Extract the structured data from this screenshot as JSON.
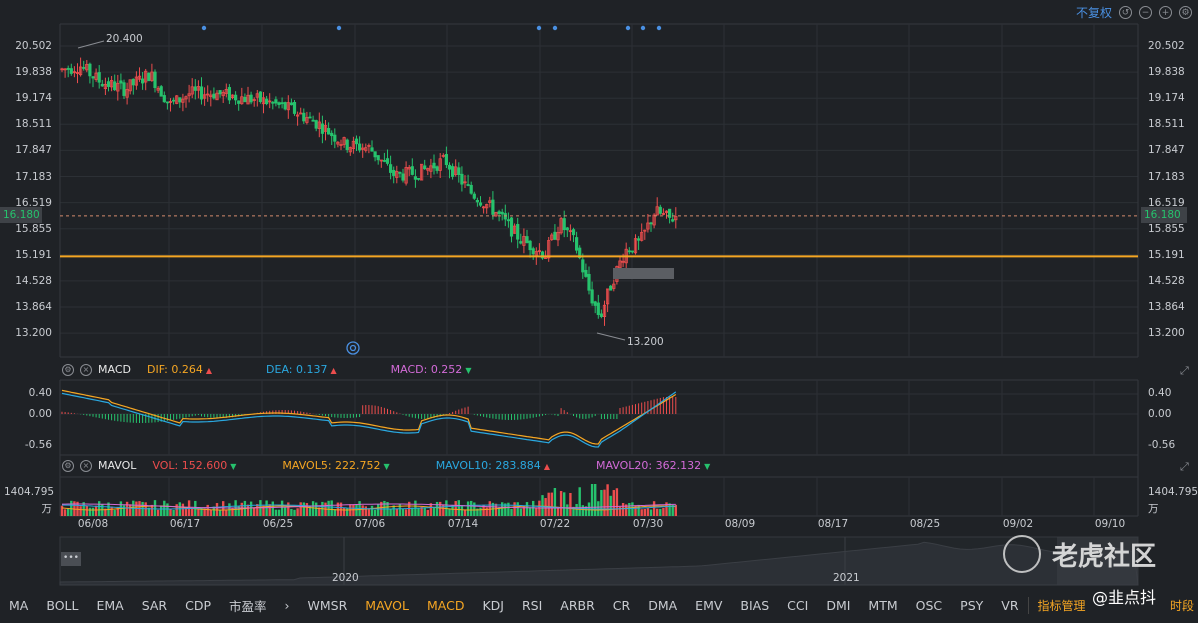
{
  "top": {
    "no_restore": "不复权"
  },
  "main": {
    "yticks": [
      "20.502",
      "19.838",
      "19.174",
      "18.511",
      "17.847",
      "17.183",
      "16.519",
      "15.855",
      "15.191",
      "14.528",
      "13.864",
      "13.200"
    ],
    "current_price": "16.180",
    "high_label": "20.400",
    "low_label": "13.200",
    "support_level": 15.15,
    "current_price_value": 16.18
  },
  "macd": {
    "name": "MACD",
    "dif": "DIF: 0.264",
    "dea": "DEA: 0.137",
    "macd": "MACD: 0.252",
    "yticks": [
      "0.40",
      "0.00",
      "-0.56"
    ]
  },
  "mavol": {
    "name": "MAVOL",
    "vol": "VOL: 152.600",
    "ma5": "MAVOL5: 222.752",
    "ma10": "MAVOL10: 283.884",
    "ma20": "MAVOL20: 362.132",
    "ytick": "1404.795",
    "unit": "万"
  },
  "xaxis": [
    "06/08",
    "06/17",
    "06/25",
    "07/06",
    "07/14",
    "07/22",
    "07/30",
    "08/09",
    "08/17",
    "08/25",
    "09/02",
    "09/10"
  ],
  "overview": {
    "years": [
      "2020",
      "2021"
    ],
    "handle": "•••"
  },
  "toolbar": {
    "items": [
      "MA",
      "BOLL",
      "EMA",
      "SAR",
      "CDP",
      "市盈率",
      "›",
      "WMSR",
      "MAVOL",
      "MACD",
      "KDJ",
      "RSI",
      "ARBR",
      "CR",
      "DMA",
      "EMV",
      "BIAS",
      "CCI",
      "DMI",
      "MTM",
      "OSC",
      "PSY",
      "VR",
      "指标管理"
    ],
    "active": [
      "MAVOL",
      "MACD"
    ],
    "timeperiod": "时段"
  },
  "watermark": {
    "site": "老虎社区",
    "user": "@韭点抖"
  },
  "colors": {
    "up": "#ec4d4d",
    "down": "#26c26d",
    "support": "#f5a623",
    "dif": "#f5a623",
    "dea": "#2aa8e0",
    "ma20": "#d36bd8"
  },
  "chart_data": {
    "type": "candlestick",
    "x_range": [
      "06/08",
      "07/31"
    ],
    "ylim": [
      13.2,
      20.502
    ],
    "high": 20.4,
    "low": 13.2,
    "last": 16.18,
    "macd_ylim": [
      -0.56,
      0.4
    ],
    "volume_max": 1404.795
  }
}
